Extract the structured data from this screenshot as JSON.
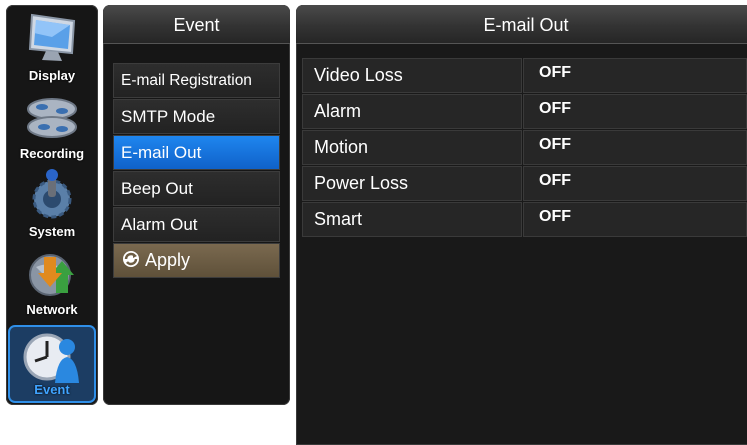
{
  "sidebar": {
    "items": [
      {
        "label": "Display",
        "icon": "monitor-icon",
        "active": false
      },
      {
        "label": "Recording",
        "icon": "film-reels-icon",
        "active": false
      },
      {
        "label": "System",
        "icon": "gear-joystick-icon",
        "active": false
      },
      {
        "label": "Network",
        "icon": "globe-arrows-icon",
        "active": false
      },
      {
        "label": "Event",
        "icon": "clock-person-icon",
        "active": true
      }
    ]
  },
  "menu": {
    "title": "Event",
    "items": [
      {
        "label": "E-mail Registration"
      },
      {
        "label": "SMTP Mode"
      },
      {
        "label": "E-mail Out"
      },
      {
        "label": "Beep Out"
      },
      {
        "label": "Alarm Out"
      }
    ],
    "apply_label": "Apply",
    "active_index": 2
  },
  "panel": {
    "title": "E-mail Out",
    "rows": [
      {
        "name": "Video Loss",
        "value": "OFF"
      },
      {
        "name": "Alarm",
        "value": "OFF"
      },
      {
        "name": "Motion",
        "value": "OFF"
      },
      {
        "name": "Power Loss",
        "value": "OFF"
      },
      {
        "name": "Smart",
        "value": "OFF"
      }
    ]
  },
  "colors": {
    "accent": "#1a7be6",
    "apply": "#6e5e45",
    "background": "#161616"
  }
}
